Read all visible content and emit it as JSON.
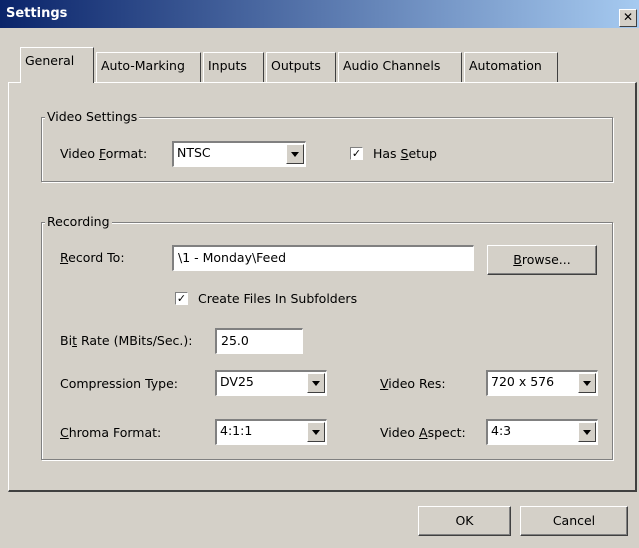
{
  "window": {
    "title": "Settings",
    "close_glyph": "✕"
  },
  "tabs": [
    "General",
    "Auto-Marking",
    "Inputs",
    "Outputs",
    "Audio Channels",
    "Automation"
  ],
  "active_tab": "General",
  "video_settings": {
    "legend": "Video Settings",
    "video_format_label": "Video Format:",
    "video_format_value": "NTSC",
    "has_setup_label": "Has Setup",
    "has_setup_checked": true
  },
  "recording": {
    "legend": "Recording",
    "record_to_label": "Record To:",
    "record_to_value": "\\1 - Monday\\Feed",
    "browse_label": "Browse...",
    "create_subfolders_label": "Create Files In Subfolders",
    "create_subfolders_checked": true,
    "bit_rate_label": "Bit Rate (MBits/Sec.):",
    "bit_rate_value": "25.0",
    "compression_label": "Compression Type:",
    "compression_value": "DV25",
    "video_res_label": "Video Res:",
    "video_res_value": "720 x 576",
    "chroma_label": "Chroma Format:",
    "chroma_value": "4:1:1",
    "video_aspect_label": "Video Aspect:",
    "video_aspect_value": "4:3"
  },
  "footer": {
    "ok_label": "OK",
    "cancel_label": "Cancel"
  }
}
